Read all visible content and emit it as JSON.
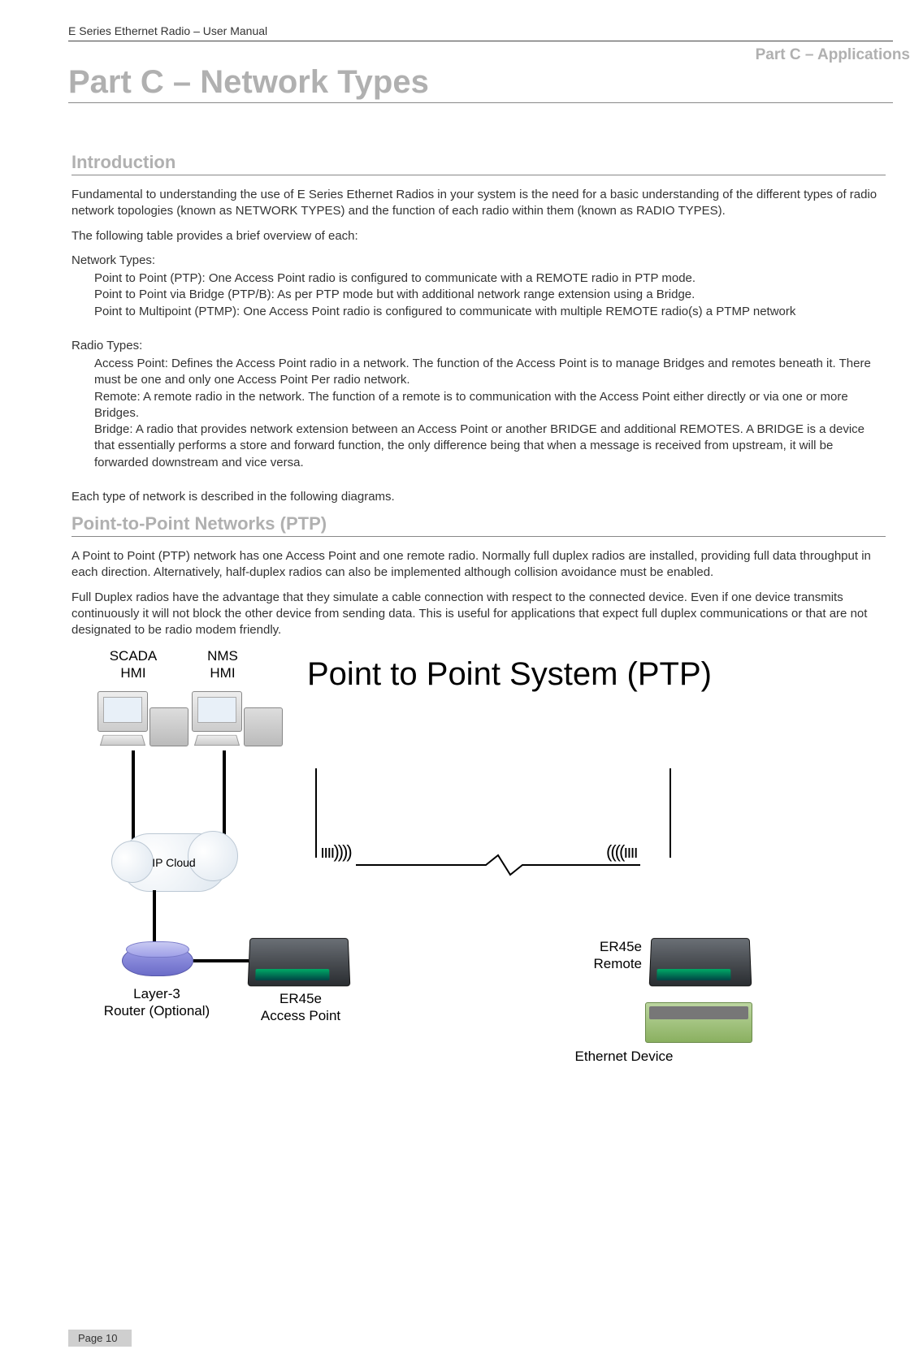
{
  "header": {
    "manual_title": "E Series Ethernet Radio – User Manual"
  },
  "part_label": "Part C – Applications",
  "part_title": "Part C – Network Types",
  "intro": {
    "heading": "Introduction",
    "p1": "Fundamental to understanding the use of E Series Ethernet Radios in your system is the need for a basic understanding of the different types of radio network topologies (known as NETWORK TYPES) and the function of each radio within them (known as RADIO TYPES).",
    "p2": "The following table provides a brief overview of each:",
    "net_types_label": "Network Types:",
    "net_types": [
      "Point to Point (PTP): One Access Point radio is configured to communicate with a REMOTE radio in PTP mode.",
      "Point to Point via Bridge (PTP/B): As per PTP mode but with additional network range extension using a Bridge.",
      "Point to Multipoint (PTMP): One Access Point radio is configured to communicate with multiple REMOTE radio(s) a PTMP network"
    ],
    "radio_types_label": "Radio Types:",
    "radio_types": [
      "Access Point: Defines the Access Point radio in a network. The function of the Access Point is to manage Bridges and remotes beneath it. There must be one and only one Access Point Per radio network.",
      "Remote: A remote radio in the network. The function of a remote is to communication with the Access Point either directly or via one or more Bridges.",
      "Bridge: A radio that provides network extension between an Access Point or another BRIDGE and additional REMOTES. A BRIDGE is a device that essentially performs a store and forward function, the only difference being that when a message is received from upstream, it will be forwarded downstream and vice versa."
    ],
    "p3": "Each type of network is described in the following diagrams."
  },
  "ptp": {
    "heading": "Point-to-Point Networks (PTP)",
    "p1": "A Point to Point (PTP) network has one Access Point and one remote radio. Normally full duplex radios are installed, providing full data throughput in each direction. Alternatively, half-duplex radios can also be implemented although collision avoidance must be enabled.",
    "p2": "Full Duplex radios have the advantage that they simulate a cable connection with respect to the connected device. Even if one device transmits continuously it will not block the other device from sending data. This is useful for applications that expect full duplex communications or that are not designated to be radio modem friendly."
  },
  "diagram": {
    "title": "Point to Point System (PTP)",
    "scada": "SCADA\nHMI",
    "nms": "NMS\nHMI",
    "ipcloud": "IP Cloud",
    "router": "Layer-3\nRouter (Optional)",
    "ap": "ER45e\nAccess Point",
    "remote": "ER45e\nRemote",
    "ethdev": "Ethernet Device"
  },
  "footer": {
    "page": "Page 10"
  }
}
